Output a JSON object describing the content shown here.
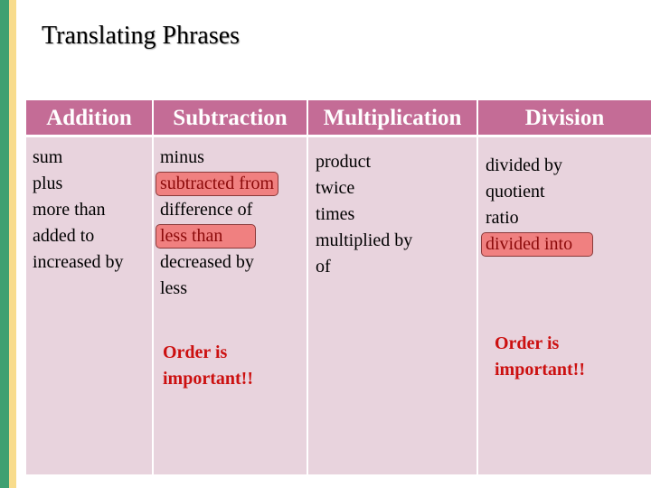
{
  "title": "Translating Phrases",
  "columns": [
    {
      "header": "Addition",
      "items": [
        "sum",
        "plus",
        "more than",
        "added to",
        "increased by"
      ]
    },
    {
      "header": "Subtraction",
      "items": [
        "minus",
        "subtracted from",
        "difference of",
        "less than",
        "decreased by",
        "less"
      ],
      "highlighted": [
        "subtracted from",
        "less than"
      ],
      "note": "Order is important!!"
    },
    {
      "header": "Multiplication",
      "items": [
        "product",
        "twice",
        "times",
        "multiplied by",
        "of"
      ]
    },
    {
      "header": "Division",
      "items": [
        "divided by",
        "quotient",
        "ratio",
        "divided into"
      ],
      "highlighted": [
        "divided into"
      ],
      "note": "Order is important!!"
    }
  ],
  "colors": {
    "header_bg": "#c46c96",
    "cell_bg": "#e8d3dd",
    "highlight": "#f08080",
    "note": "#cc1010",
    "accent_green": "#3fa071",
    "accent_yellow": "#f8dc8c"
  }
}
